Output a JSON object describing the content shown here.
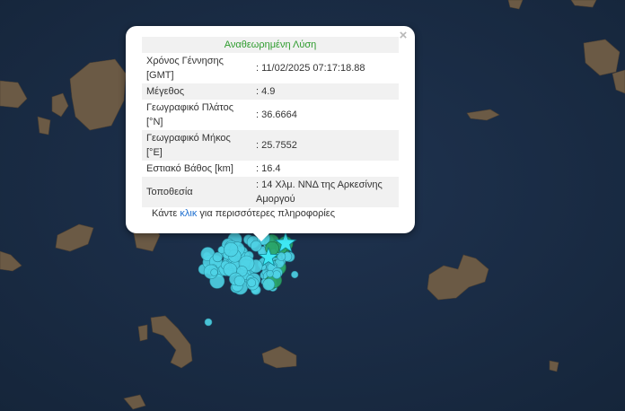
{
  "popup": {
    "title": "Αναθεωρημένη Λύση",
    "close_symbol": "×",
    "rows": [
      {
        "label": "Χρόνος Γέννησης [GMT]",
        "value": ": 11/02/2025 07:17:18.88"
      },
      {
        "label": "Μέγεθος",
        "value": ": 4.9"
      },
      {
        "label": "Γεωγραφικό Πλάτος [°N]",
        "value": ": 36.6664"
      },
      {
        "label": "Γεωγραφικό Μήκος [°E]",
        "value": ": 25.7552"
      },
      {
        "label": "Εστιακό Βάθος [km]",
        "value": ": 16.4"
      },
      {
        "label": "Τοποθεσία",
        "value": ": 14 Χλμ. ΝΝΔ της Αρκεσίνης Αμοργού"
      }
    ],
    "more_prefix": "Κάντε",
    "more_link": "κλικ",
    "more_suffix": "για περισσότερες πληροφορίες"
  },
  "colors": {
    "sea": "#1b2d44",
    "land": "#6b5a45",
    "quake_cyan": "#4fd3e6",
    "quake_green": "#2aa56a",
    "star": "#3fe8f4",
    "title_green": "#2e9c2e",
    "link_blue": "#1e6fd0"
  }
}
